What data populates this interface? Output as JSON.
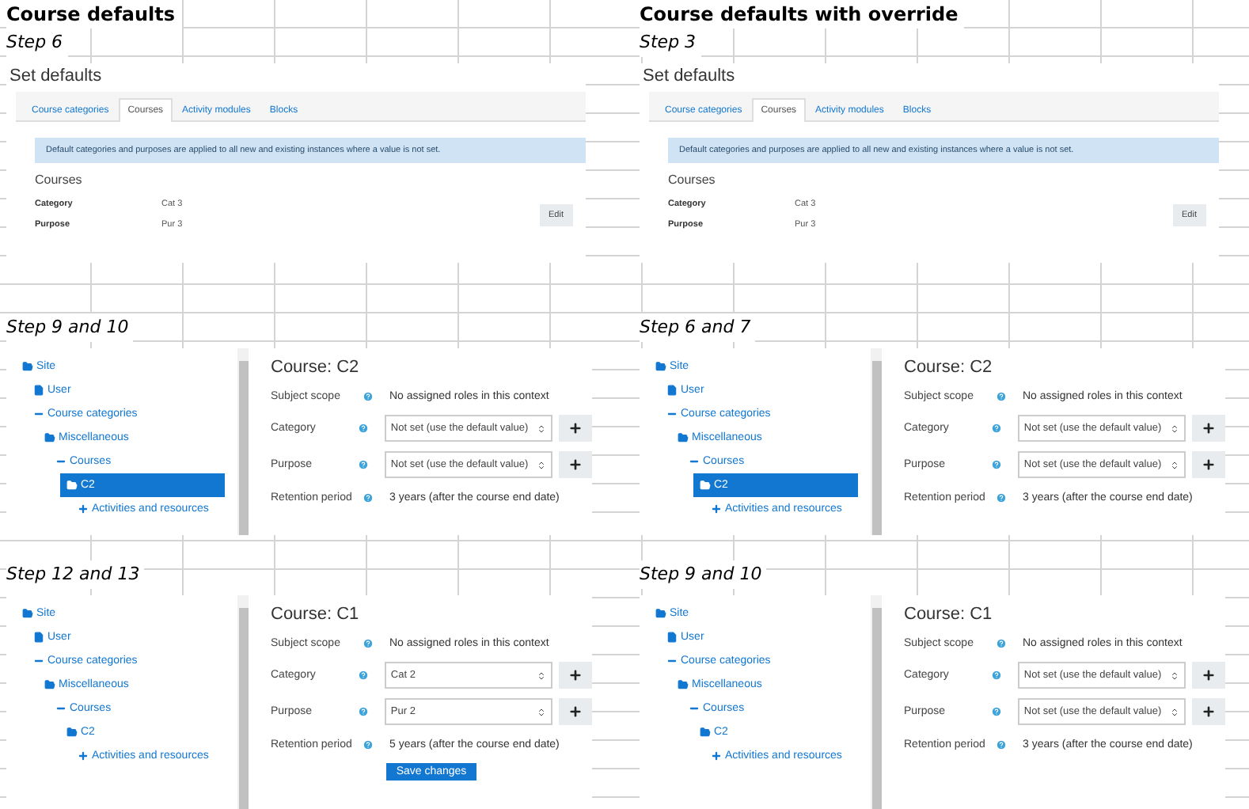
{
  "columns": [
    {
      "title": "Course defaults",
      "sections": [
        {
          "step": "Step 6",
          "kind": "defaults",
          "heading": "Set defaults",
          "tabs": [
            {
              "label": "Course categories",
              "selected": false
            },
            {
              "label": "Courses",
              "selected": true
            },
            {
              "label": "Activity modules",
              "selected": false
            },
            {
              "label": "Blocks",
              "selected": false
            }
          ],
          "notice": "Default categories and purposes are applied to all new and existing instances where a value is not set.",
          "section_title": "Courses",
          "fields": [
            {
              "label": "Category",
              "value": "Cat 3"
            },
            {
              "label": "Purpose",
              "value": "Pur 3"
            }
          ],
          "button": "Edit"
        },
        {
          "step": "Step 9 and 10",
          "kind": "course",
          "tree": [
            {
              "label": "Site",
              "kind": "folder",
              "selected": false,
              "children": [
                {
                  "label": "User",
                  "kind": "file",
                  "selected": false
                },
                {
                  "label": "Course categories",
                  "kind": "expanded",
                  "selected": false,
                  "children": [
                    {
                      "label": "Miscellaneous",
                      "kind": "folder",
                      "selected": false,
                      "children": [
                        {
                          "label": "Courses",
                          "kind": "expanded",
                          "selected": false,
                          "children": [
                            {
                              "label": "C2",
                              "kind": "folder",
                              "selected": true,
                              "children": [
                                {
                                  "label": "Activities and resources",
                                  "kind": "collapsed",
                                  "selected": false
                                }
                              ]
                            }
                          ]
                        }
                      ]
                    }
                  ]
                }
              ]
            }
          ],
          "title": "Course: C2",
          "fields": [
            {
              "label": "Subject scope",
              "kind": "text",
              "value": "No assigned roles in this context"
            },
            {
              "label": "Category",
              "kind": "select",
              "value": "Not set (use the default value)"
            },
            {
              "label": "Purpose",
              "kind": "select",
              "value": "Not set (use the default value)"
            },
            {
              "label": "Retention period",
              "kind": "text",
              "value": "3 years (after the course end date)"
            }
          ]
        },
        {
          "step": "Step 12 and 13",
          "kind": "course",
          "tree": [
            {
              "label": "Site",
              "kind": "folder",
              "selected": false,
              "children": [
                {
                  "label": "User",
                  "kind": "file",
                  "selected": false
                },
                {
                  "label": "Course categories",
                  "kind": "expanded",
                  "selected": false,
                  "children": [
                    {
                      "label": "Miscellaneous",
                      "kind": "folder",
                      "selected": false,
                      "children": [
                        {
                          "label": "Courses",
                          "kind": "expanded",
                          "selected": false,
                          "children": [
                            {
                              "label": "C2",
                              "kind": "folder",
                              "selected": false,
                              "children": [
                                {
                                  "label": "Activities and resources",
                                  "kind": "collapsed",
                                  "selected": false
                                }
                              ]
                            }
                          ]
                        }
                      ]
                    }
                  ]
                }
              ]
            }
          ],
          "title": "Course: C1",
          "fields": [
            {
              "label": "Subject scope",
              "kind": "text",
              "value": "No assigned roles in this context"
            },
            {
              "label": "Category",
              "kind": "select",
              "value": "Cat 2"
            },
            {
              "label": "Purpose",
              "kind": "select",
              "value": "Pur 2"
            },
            {
              "label": "Retention period",
              "kind": "text",
              "value": "5 years (after the course end date)"
            }
          ],
          "save_button": "Save changes"
        }
      ]
    },
    {
      "title": "Course defaults with override",
      "sections": [
        {
          "step": "Step 3",
          "kind": "defaults",
          "heading": "Set defaults",
          "tabs": [
            {
              "label": "Course categories",
              "selected": false
            },
            {
              "label": "Courses",
              "selected": true
            },
            {
              "label": "Activity modules",
              "selected": false
            },
            {
              "label": "Blocks",
              "selected": false
            }
          ],
          "notice": "Default categories and purposes are applied to all new and existing instances where a value is not set.",
          "section_title": "Courses",
          "fields": [
            {
              "label": "Category",
              "value": "Cat 3"
            },
            {
              "label": "Purpose",
              "value": "Pur 3"
            }
          ],
          "button": "Edit"
        },
        {
          "step": "Step 6 and 7",
          "kind": "course",
          "tree": [
            {
              "label": "Site",
              "kind": "folder",
              "selected": false,
              "children": [
                {
                  "label": "User",
                  "kind": "file",
                  "selected": false
                },
                {
                  "label": "Course categories",
                  "kind": "expanded",
                  "selected": false,
                  "children": [
                    {
                      "label": "Miscellaneous",
                      "kind": "folder",
                      "selected": false,
                      "children": [
                        {
                          "label": "Courses",
                          "kind": "expanded",
                          "selected": false,
                          "children": [
                            {
                              "label": "C2",
                              "kind": "folder",
                              "selected": true,
                              "children": [
                                {
                                  "label": "Activities and resources",
                                  "kind": "collapsed",
                                  "selected": false
                                }
                              ]
                            }
                          ]
                        }
                      ]
                    }
                  ]
                }
              ]
            }
          ],
          "title": "Course: C2",
          "fields": [
            {
              "label": "Subject scope",
              "kind": "text",
              "value": "No assigned roles in this context"
            },
            {
              "label": "Category",
              "kind": "select",
              "value": "Not set (use the default value)"
            },
            {
              "label": "Purpose",
              "kind": "select",
              "value": "Not set (use the default value)"
            },
            {
              "label": "Retention period",
              "kind": "text",
              "value": "3 years (after the course end date)"
            }
          ]
        },
        {
          "step": "Step 9 and 10",
          "kind": "course",
          "tree": [
            {
              "label": "Site",
              "kind": "folder",
              "selected": false,
              "children": [
                {
                  "label": "User",
                  "kind": "file",
                  "selected": false
                },
                {
                  "label": "Course categories",
                  "kind": "expanded",
                  "selected": false,
                  "children": [
                    {
                      "label": "Miscellaneous",
                      "kind": "folder",
                      "selected": false,
                      "children": [
                        {
                          "label": "Courses",
                          "kind": "expanded",
                          "selected": false,
                          "children": [
                            {
                              "label": "C2",
                              "kind": "folder",
                              "selected": false,
                              "children": [
                                {
                                  "label": "Activities and resources",
                                  "kind": "collapsed",
                                  "selected": false
                                }
                              ]
                            }
                          ]
                        }
                      ]
                    }
                  ]
                }
              ]
            }
          ],
          "title": "Course: C1",
          "fields": [
            {
              "label": "Subject scope",
              "kind": "text",
              "value": "No assigned roles in this context"
            },
            {
              "label": "Category",
              "kind": "select",
              "value": "Not set (use the default value)"
            },
            {
              "label": "Purpose",
              "kind": "select",
              "value": "Not set (use the default value)"
            },
            {
              "label": "Retention period",
              "kind": "text",
              "value": "3 years (after the course end date)"
            }
          ]
        }
      ]
    }
  ]
}
